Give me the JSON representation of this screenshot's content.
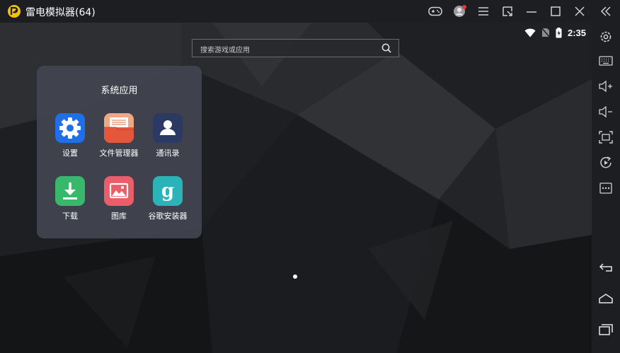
{
  "window": {
    "title": "雷电模拟器(64)"
  },
  "status_bar": {
    "time": "2:35"
  },
  "search": {
    "placeholder": "搜索游戏或应用"
  },
  "folder": {
    "title": "系统应用",
    "apps": [
      {
        "label": "设置",
        "icon": "settings-gear-icon",
        "color": "#1f6fe8"
      },
      {
        "label": "文件管理器",
        "icon": "file-manager-icon",
        "color": "#e4573a"
      },
      {
        "label": "通讯录",
        "icon": "contacts-icon",
        "color": "#2a3a63"
      },
      {
        "label": "下载",
        "icon": "download-icon",
        "color": "#38b86a"
      },
      {
        "label": "图库",
        "icon": "gallery-icon",
        "color": "#ec5d6a"
      },
      {
        "label": "谷歌安装器",
        "icon": "google-installer-icon",
        "color": "#2ab3b8"
      }
    ]
  },
  "colors": {
    "titlebar": "#1d1e22",
    "folder_bg": "#424550",
    "notification_dot": "#e53935"
  },
  "titlebar_icons": [
    "logo-icon",
    "gamepad-icon",
    "user-avatar-icon",
    "menu-icon",
    "crop-icon",
    "minimize-icon",
    "maximize-icon",
    "close-icon",
    "collapse-sidebar-icon"
  ],
  "sidebar_icons": [
    "settings-icon",
    "keyboard-icon",
    "volume-up-icon",
    "volume-down-icon",
    "screenshot-icon",
    "rotate-icon",
    "more-icon",
    "back-icon",
    "home-icon",
    "recent-apps-icon"
  ]
}
